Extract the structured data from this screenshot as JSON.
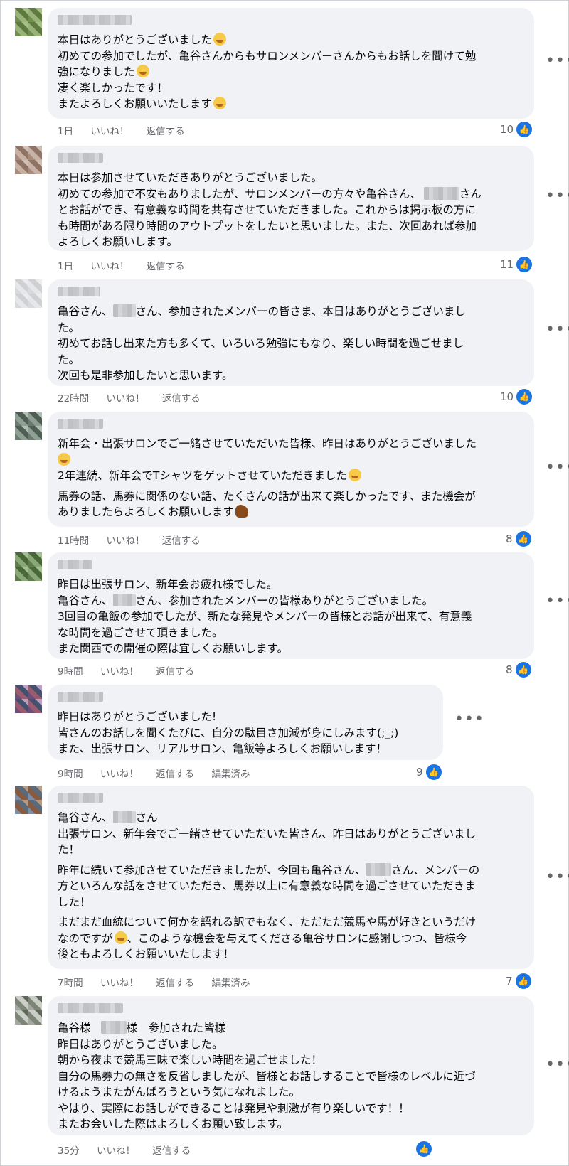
{
  "ui": {
    "more_label": "•••",
    "like_glyph": "👍"
  },
  "comments": [
    {
      "lines": [
        "本日はありがとうございました",
        "初めての参加でしたが、亀谷さんからもサロンメンバーさんからもお話しを聞けて勉",
        "強になりました",
        "凄く楽しかったです！",
        "またよろしくお願いいたします"
      ],
      "time": "1日",
      "like": "いいね！",
      "reply": "返信する",
      "edited": "",
      "likes": "10"
    },
    {
      "lines": [
        "本日は参加させていただきありがとうございました。",
        "初めての参加で不安もありましたが、サロンメンバーの方々や亀谷さん、",
        "とお話ができ、有意義な時間を共有させていただきました。これからは掲示板の方に",
        "も時間がある限り時間のアウトプットをしたいと思いました。また、次回あれば参加",
        "よろしくお願いします。"
      ],
      "name_tail": "さん",
      "time": "1日",
      "like": "いいね！",
      "reply": "返信する",
      "edited": "",
      "likes": "11"
    },
    {
      "lines": [
        "亀谷さん、",
        "さん、参加されたメンバーの皆さま、本日はありがとうございまし",
        "た。",
        "初めてお話し出来た方も多くて、いろいろ勉強にもなり、楽しい時間を過ごせまし",
        "た。",
        "次回も是非参加したいと思います。"
      ],
      "time": "22時間",
      "like": "いいね！",
      "reply": "返信する",
      "edited": "",
      "likes": "10"
    },
    {
      "lines": [
        "新年会・出張サロンでご一緒させていただいた皆様、昨日はありがとうございました",
        "2年連続、新年会でTシャツをゲットさせていただきました",
        "馬券の話、馬券に関係のない話、たくさんの話が出来て楽しかったです、また機会が",
        "ありましたらよろしくお願いします"
      ],
      "time": "11時間",
      "like": "いいね！",
      "reply": "返信する",
      "edited": "",
      "likes": "8"
    },
    {
      "lines": [
        "昨日は出張サロン、新年会お疲れ様でした。",
        "亀谷さん、",
        "さん、参加されたメンバーの皆様ありがとうございました。",
        "3回目の亀飯の参加でしたが、新たな発見やメンバーの皆様とお話が出来て、有意義",
        "な時間を過ごさせて頂きました。",
        "また関西での開催の際は宜しくお願いします。"
      ],
      "time": "9時間",
      "like": "いいね！",
      "reply": "返信する",
      "edited": "",
      "likes": "8"
    },
    {
      "lines": [
        "昨日はありがとうございました!",
        "皆さんのお話しを聞くたびに、自分の駄目さ加減が身にしみます(;_;)",
        "また、出張サロン、リアルサロン、亀飯等よろしくお願いします！"
      ],
      "time": "9時間",
      "like": "いいね！",
      "reply": "返信する",
      "edited": "編集済み",
      "likes": "9"
    },
    {
      "lines": [
        "亀谷さん、",
        "さん",
        "出張サロン、新年会でご一緒させていただいた皆さん、昨日はありがとうございまし",
        "た！",
        "昨年に続いて参加させていただきましたが、今回も亀谷さん、",
        "さん、メンバーの",
        "方といろんな話をさせていただき、馬券以上に有意義な時間を過ごさせていただきま",
        "した！",
        "まだまだ血統について何かを語れる訳でもなく、ただただ競馬や馬が好きというだけ",
        "なのですが",
        "、このような機会を与えてくださる亀谷サロンに感謝しつつ、皆様今",
        "後ともよろしくお願いいたします！"
      ],
      "time": "7時間",
      "like": "いいね！",
      "reply": "返信する",
      "edited": "編集済み",
      "likes": "7"
    },
    {
      "lines": [
        "亀谷様",
        "様　参加された皆様",
        "昨日はありがとうございました。",
        "朝から夜まで競馬三昧で楽しい時間を過ごせました！",
        "自分の馬券力の無さを反省しましたが、皆様とお話しすることで皆様のレベルに近づ",
        "けるようまたがんばろうという気になれました。",
        "やはり、実際にお話しができることは発見や刺激が有り楽しいです！！",
        "またお会いした際はよろしくお願い致します。"
      ],
      "time": "35分",
      "like": "いいね！",
      "reply": "返信する",
      "edited": "",
      "likes": ""
    }
  ]
}
